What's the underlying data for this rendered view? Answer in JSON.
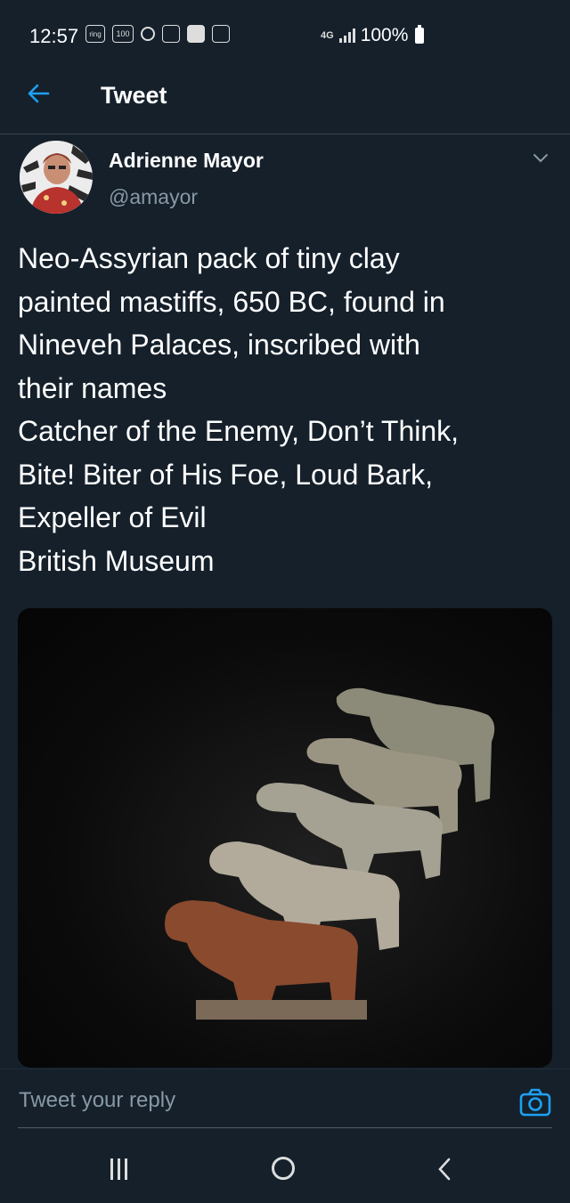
{
  "status_bar": {
    "time": "12:57",
    "ring_label": "ring",
    "badge_100": "100",
    "network": "4G",
    "battery": "100%"
  },
  "header": {
    "title": "Tweet"
  },
  "tweet": {
    "author_name": "Adrienne Mayor",
    "author_handle": "@amayor",
    "text_lines": [
      "Neo-Assyrian pack of tiny clay",
      "painted mastiffs, 650 BC, found in",
      "Nineveh Palaces, inscribed with",
      "their names",
      "Catcher of the Enemy, Don’t Think,",
      "Bite! Biter of His Foe, Loud Bark,",
      "Expeller of Evil",
      "British Museum"
    ]
  },
  "reply": {
    "placeholder": "Tweet your reply"
  },
  "colors": {
    "background": "#15202b",
    "accent": "#1da1f2",
    "secondary_text": "#8899a6"
  }
}
